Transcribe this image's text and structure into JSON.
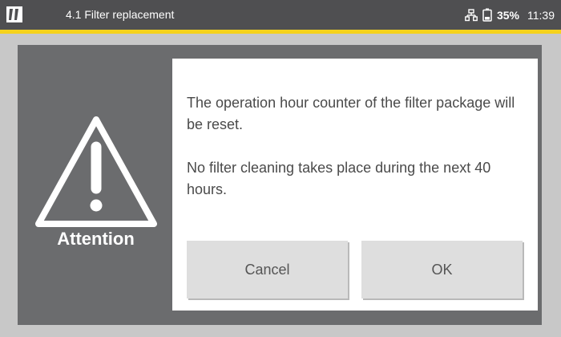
{
  "header": {
    "logo_icon": "device-logo-icon",
    "title": "4.1 Filter replacement",
    "network_icon": "network-icon",
    "battery_icon": "battery-icon",
    "battery_percent": "35%",
    "time": "11:39",
    "accent_color": "#f5d21c",
    "bar_color": "#4f4f51"
  },
  "alert": {
    "icon": "warning-triangle-icon",
    "label": "Attention",
    "panel_color": "#6b6c6e"
  },
  "dialog": {
    "message_1": "The operation hour counter of the filter package will be reset.",
    "message_2": "No filter cleaning takes place during the next 40 hours.",
    "cancel_label": "Cancel",
    "ok_label": "OK"
  }
}
